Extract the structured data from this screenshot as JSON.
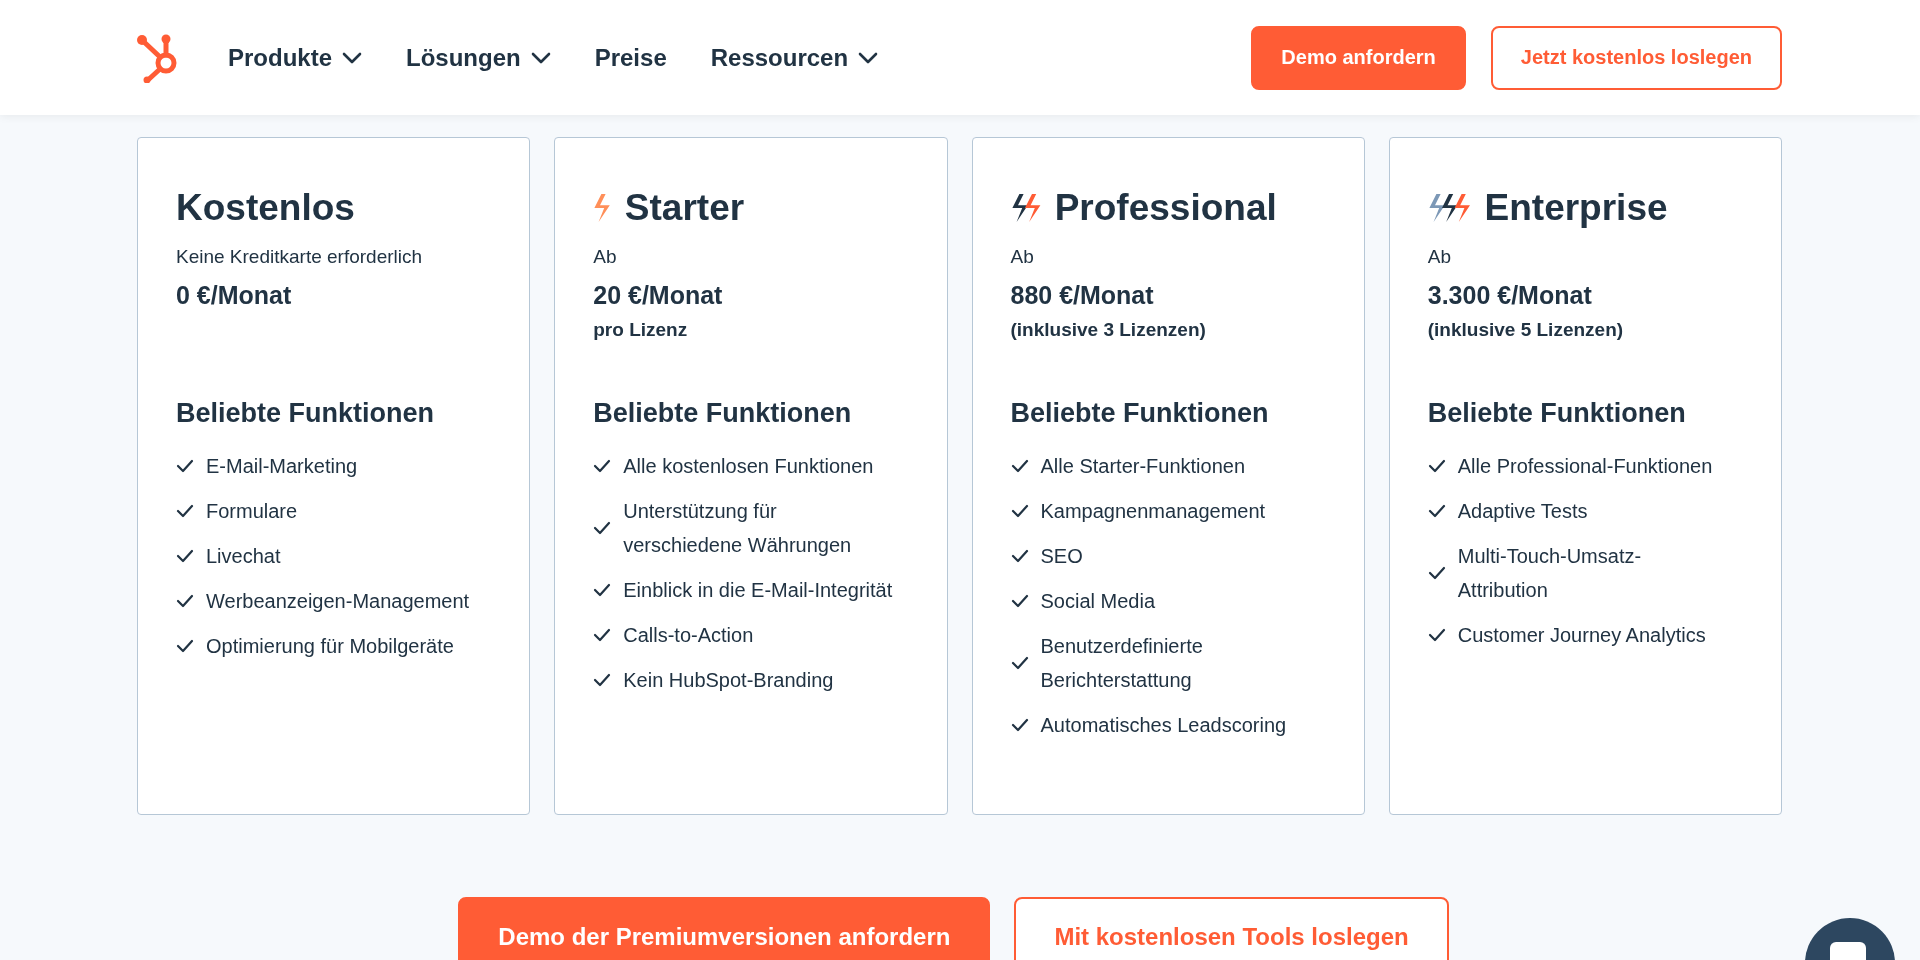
{
  "header": {
    "nav": [
      {
        "label": "Produkte",
        "has_dropdown": true
      },
      {
        "label": "Lösungen",
        "has_dropdown": true
      },
      {
        "label": "Preise",
        "has_dropdown": false
      },
      {
        "label": "Ressourcen",
        "has_dropdown": true
      }
    ],
    "buttons": [
      {
        "label": "Demo anfordern",
        "kind": "primary"
      },
      {
        "label": "Jetzt kostenlos loslegen",
        "kind": "secondary"
      }
    ]
  },
  "plans": [
    {
      "kind": "free",
      "name": "Kostenlos",
      "note": "Keine Kreditkarte erforderlich",
      "price": "0 €/Monat",
      "features_title": "Beliebte Funktionen",
      "features": [
        "E-Mail-Marketing",
        "Formulare",
        "Livechat",
        "Werbeanzeigen-Management",
        "Optimierung für Mobilgeräte"
      ]
    },
    {
      "kind": "starter",
      "name": "Starter",
      "note": "Ab",
      "price": "20 €/Monat",
      "price_detail": "pro Lizenz",
      "features_title": "Beliebte Funktionen",
      "features": [
        "Alle kostenlosen Funktionen",
        "Unterstützung für verschiedene Währungen",
        "Einblick in die E-Mail-Integrität",
        "Calls-to-Action",
        "Kein HubSpot-Branding"
      ]
    },
    {
      "kind": "professional",
      "name": "Professional",
      "note": "Ab",
      "price": "880 €/Monat",
      "price_detail": "(inklusive 3 Lizenzen)",
      "features_title": "Beliebte Funktionen",
      "features": [
        "Alle Starter-Funktionen",
        "Kampagnenmanagement",
        "SEO",
        "Social Media",
        "Benutzerdefinierte Berichterstattung",
        "Automatisches Leadscoring"
      ]
    },
    {
      "kind": "enterprise",
      "name": "Enterprise",
      "note": "Ab",
      "price": "3.300 €/Monat",
      "price_detail": "(inklusive 5 Lizenzen)",
      "features_title": "Beliebte Funktionen",
      "features": [
        "Alle Professional-Funktionen",
        "Adaptive Tests",
        "Multi-Touch-Umsatz-Attribution",
        "Customer Journey Analytics"
      ]
    }
  ],
  "cta": [
    {
      "label": "Demo der Premiumversionen anfordern",
      "kind": "primary"
    },
    {
      "label": "Mit kostenlosen Tools loslegen",
      "kind": "secondary"
    }
  ]
}
